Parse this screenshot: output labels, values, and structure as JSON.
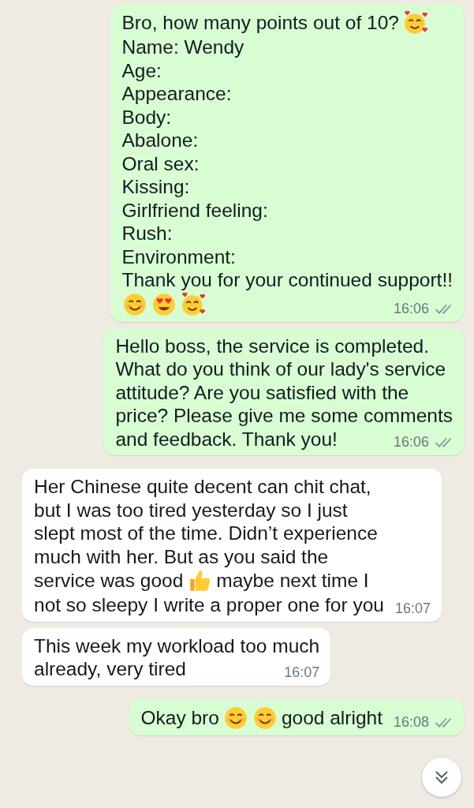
{
  "messages": [
    {
      "kind": "outgoing",
      "lines": [
        [
          {
            "kind": "text",
            "text": "Bro, how many points out of 10?"
          },
          {
            "kind": "hearts"
          }
        ],
        "Name:  Wendy",
        "Age:",
        "Appearance:",
        "Body:",
        "Abalone:",
        "Oral sex:",
        "Kissing:",
        "Girlfriend feeling:",
        "Rush:",
        "Environment:",
        "Thank you for your continued support!!",
        [
          {
            "kind": "smiling"
          },
          {
            "kind": "heart-eyes"
          },
          {
            "kind": "hearts"
          }
        ]
      ],
      "time": "16:06",
      "read": false
    },
    {
      "kind": "outgoing",
      "lines": [
        "Hello boss, the service is completed.",
        "What do you think of our lady's service",
        "attitude? Are you satisfied with the",
        "price? Please give me some comments",
        "and feedback. Thank you!"
      ],
      "time": "16:06",
      "read": false
    },
    {
      "kind": "incoming",
      "lines": [
        "Her Chinese quite decent can chit chat,",
        "but I was too tired yesterday so I just",
        "slept most of the time. Didn’t experience",
        "much with her. But as you said the",
        [
          {
            "kind": "text",
            "text": "service was good"
          },
          {
            "kind": "thumbs-up"
          },
          {
            "kind": "text",
            "text": "maybe next time I"
          }
        ],
        "not so sleepy I write a proper one for you"
      ],
      "time": "16:07"
    },
    {
      "kind": "incoming",
      "lines": [
        "This week my workload too much",
        "already, very tired"
      ],
      "time": "16:07"
    },
    {
      "kind": "outgoing",
      "lines": [
        [
          {
            "kind": "text",
            "text": "Okay bro"
          },
          {
            "kind": "smiling"
          },
          {
            "kind": "smiling"
          },
          {
            "kind": "text",
            "text": "good alright"
          }
        ]
      ],
      "time": "16:08",
      "read": false
    }
  ]
}
